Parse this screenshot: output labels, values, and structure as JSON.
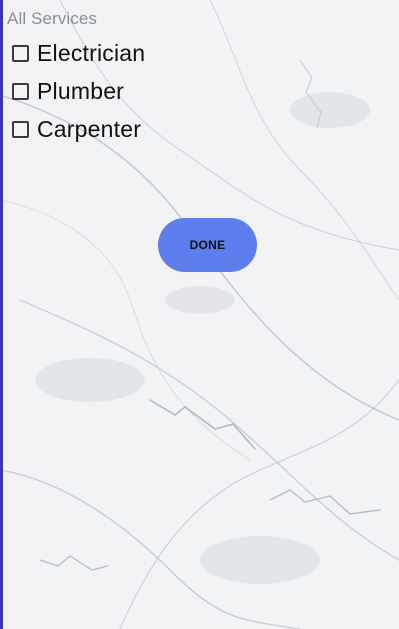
{
  "section_title": "All Services",
  "services": [
    {
      "label": "Electrician",
      "checked": false
    },
    {
      "label": "Plumber",
      "checked": false
    },
    {
      "label": "Carpenter",
      "checked": false
    }
  ],
  "done_button": {
    "label": "DONE"
  },
  "colors": {
    "button_bg": "#5f7eee",
    "title_text": "#8a8e95",
    "label_text": "#111111",
    "left_edge": "#3a3aa0"
  }
}
